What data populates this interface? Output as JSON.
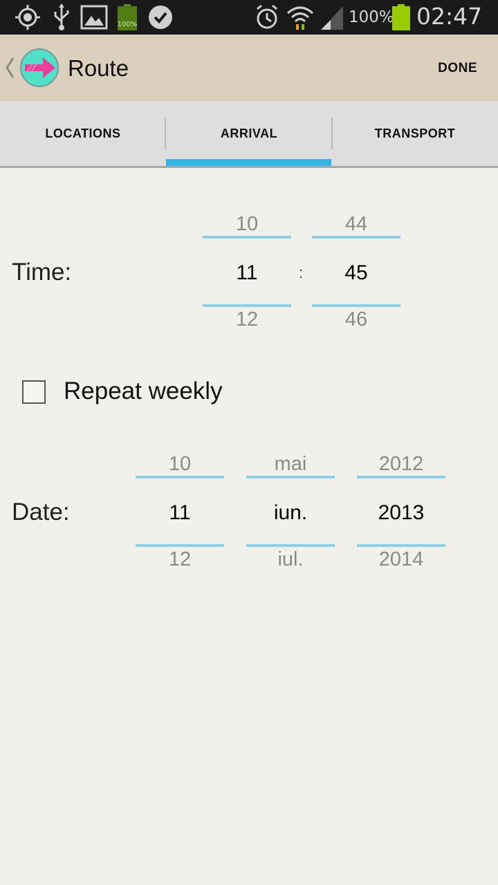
{
  "status_bar": {
    "icons_left": [
      "gps-icon",
      "usb-icon",
      "gallery-icon",
      "battery-saver-icon",
      "skype-icon"
    ],
    "battery_small_label": "100%",
    "icons_right": [
      "alarm-icon",
      "wifi-icon",
      "signal-icon",
      "battery-icon"
    ],
    "battery_percent": "100%",
    "clock": "02:47"
  },
  "action_bar": {
    "title": "Route",
    "done_label": "DONE"
  },
  "tabs": [
    {
      "label": "LOCATIONS",
      "selected": false
    },
    {
      "label": "ARRIVAL",
      "selected": true
    },
    {
      "label": "TRANSPORT",
      "selected": false
    }
  ],
  "colors": {
    "accent": "#33b5e5",
    "picker_line": "#8ecfe6",
    "action_bar": "#dad0bd",
    "background": "#f2f0ea"
  },
  "time": {
    "label": "Time:",
    "separator": ":",
    "hour": {
      "prev": "10",
      "current": "11",
      "next": "12"
    },
    "minute": {
      "prev": "44",
      "current": "45",
      "next": "46"
    }
  },
  "repeat": {
    "label": "Repeat weekly",
    "checked": false
  },
  "date": {
    "label": "Date:",
    "day": {
      "prev": "10",
      "current": "11",
      "next": "12"
    },
    "month": {
      "prev": "mai",
      "current": "iun.",
      "next": "iul."
    },
    "year": {
      "prev": "2012",
      "current": "2013",
      "next": "2014"
    }
  }
}
